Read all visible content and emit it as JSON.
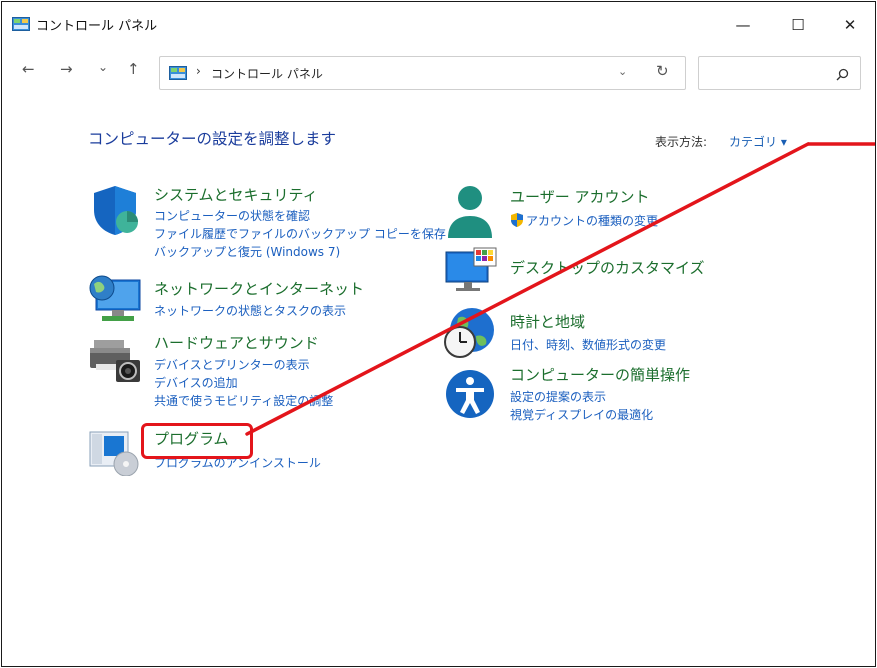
{
  "window": {
    "title": "コントロール パネル",
    "minimize": "—",
    "maximize": "☐",
    "close": "✕"
  },
  "nav": {
    "back": "←",
    "forward": "→",
    "recent": "⌄",
    "up": "↑",
    "breadcrumb_sep": "›",
    "breadcrumb": "コントロール パネル",
    "dropdown": "⌄",
    "refresh": "↻",
    "search_placeholder": ""
  },
  "main": {
    "heading": "コンピューターの設定を調整します",
    "view_by_label": "表示方法:",
    "view_by_value": "カテゴリ ▾",
    "categories": [
      {
        "title": "システムとセキュリティ",
        "links": [
          "コンピューターの状態を確認",
          "ファイル履歴でファイルのバックアップ コピーを保存",
          "バックアップと復元 (Windows 7)"
        ]
      },
      {
        "title": "ネットワークとインターネット",
        "links": [
          "ネットワークの状態とタスクの表示"
        ]
      },
      {
        "title": "ハードウェアとサウンド",
        "links": [
          "デバイスとプリンターの表示",
          "デバイスの追加",
          "共通で使うモビリティ設定の調整"
        ]
      },
      {
        "title": "プログラム",
        "links": [
          "プログラムのアンインストール"
        ]
      },
      {
        "title": "ユーザー アカウント",
        "links": [
          "アカウントの種類の変更"
        ]
      },
      {
        "title": "デスクトップのカスタマイズ",
        "links": []
      },
      {
        "title": "時計と地域",
        "links": [
          "日付、時刻、数値形式の変更"
        ]
      },
      {
        "title": "コンピューターの簡単操作",
        "links": [
          "設定の提案の表示",
          "視覚ディスプレイの最適化"
        ]
      }
    ]
  },
  "annotation": {
    "color": "#e3151b"
  }
}
